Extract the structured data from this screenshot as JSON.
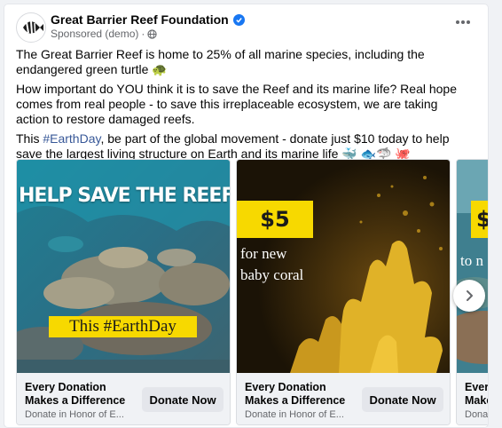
{
  "post": {
    "page_name": "Great Barrier Reef Foundation",
    "sponsored_label": "Sponsored (demo)",
    "dot_separator": "·",
    "paragraphs": {
      "p1": "The Great Barrier Reef is home to 25% of all marine species, including the endangered green turtle 🐢",
      "p2": "How important do YOU think it is to save the Reef and its marine life? Real hope comes from real people - to save this irreplaceable ecosystem, we are taking action to restore damaged reefs.",
      "p3_before": "This ",
      "p3_hashtag": "#EarthDay",
      "p3_after": ", be part of the global movement - donate just $10 today to help save the largest living structure on Earth and its marine life 🐳 🐟🦈 🐙"
    }
  },
  "carousel": {
    "cards": [
      {
        "overlay_headline": "HELP SAVE THE REEF",
        "overlay_tag": "This #EarthDay",
        "title": "Every Donation Makes a Difference",
        "subtitle": "Donate in Honor of E...",
        "button_label": "Donate Now"
      },
      {
        "overlay_price": "$5",
        "overlay_caption_line1": "for new",
        "overlay_caption_line2": "baby coral",
        "title": "Every Donation Makes a Difference",
        "subtitle": "Donate in Honor of E...",
        "button_label": "Donate Now"
      },
      {
        "overlay_price": "$",
        "overlay_caption_line1": "to n",
        "title": "Ever Make",
        "subtitle": "Dona"
      }
    ]
  },
  "colors": {
    "accent_blue": "#1877f2",
    "hashtag_blue": "#385898",
    "overlay_yellow": "#f7d900",
    "button_grey": "#e4e6eb",
    "footer_grey": "#f0f2f5"
  },
  "icons": [
    "verified-badge-icon",
    "globe-icon",
    "more-options-icon",
    "chevron-right-icon"
  ]
}
